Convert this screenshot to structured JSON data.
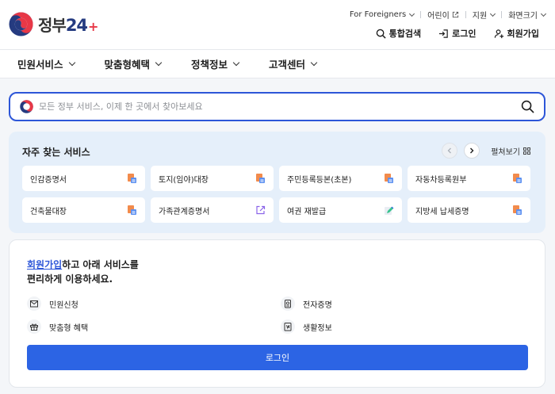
{
  "logo": {
    "text": "정부",
    "num": "24",
    "plus": "+"
  },
  "util": [
    {
      "label": "For Foreigners"
    },
    {
      "label": "어린이"
    },
    {
      "label": "지원"
    },
    {
      "label": "화면크기"
    }
  ],
  "actions": {
    "search": "통합검색",
    "login": "로그인",
    "signup": "회원가입"
  },
  "gnb": [
    "민원서비스",
    "맞춤형혜택",
    "정책정보",
    "고객센터"
  ],
  "search": {
    "placeholder": "모든 정부 서비스, 이제 한 곳에서 찾아보세요"
  },
  "frequent": {
    "title": "자주 찾는 서비스",
    "unfold": "펼쳐보기",
    "items": [
      {
        "label": "인감증명서",
        "icon": "document-icon"
      },
      {
        "label": "토지(임야)대장",
        "icon": "document-icon"
      },
      {
        "label": "주민등록등본(초본)",
        "icon": "document-icon"
      },
      {
        "label": "자동차등록원부",
        "icon": "document-icon"
      },
      {
        "label": "건축물대장",
        "icon": "document-icon"
      },
      {
        "label": "가족관계증명서",
        "icon": "external-link-icon"
      },
      {
        "label": "여권 재발급",
        "icon": "pencil-icon"
      },
      {
        "label": "지방세 납세증명",
        "icon": "document-icon"
      }
    ]
  },
  "login_box": {
    "signup_link": "회원가입",
    "line1_rest": "하고 아래 서비스를",
    "line2": "편리하게 이용하세요.",
    "items": [
      {
        "label": "민원신청",
        "icon": "mail-icon"
      },
      {
        "label": "전자증명",
        "icon": "certificate-icon"
      },
      {
        "label": "맞춤형 혜택",
        "icon": "gift-icon"
      },
      {
        "label": "생활정보",
        "icon": "book-icon"
      }
    ],
    "button": "로그인"
  },
  "colors": {
    "primary": "#2c64e4",
    "accent_red": "#e73847",
    "navy": "#253b80",
    "panel": "#e5effa"
  }
}
